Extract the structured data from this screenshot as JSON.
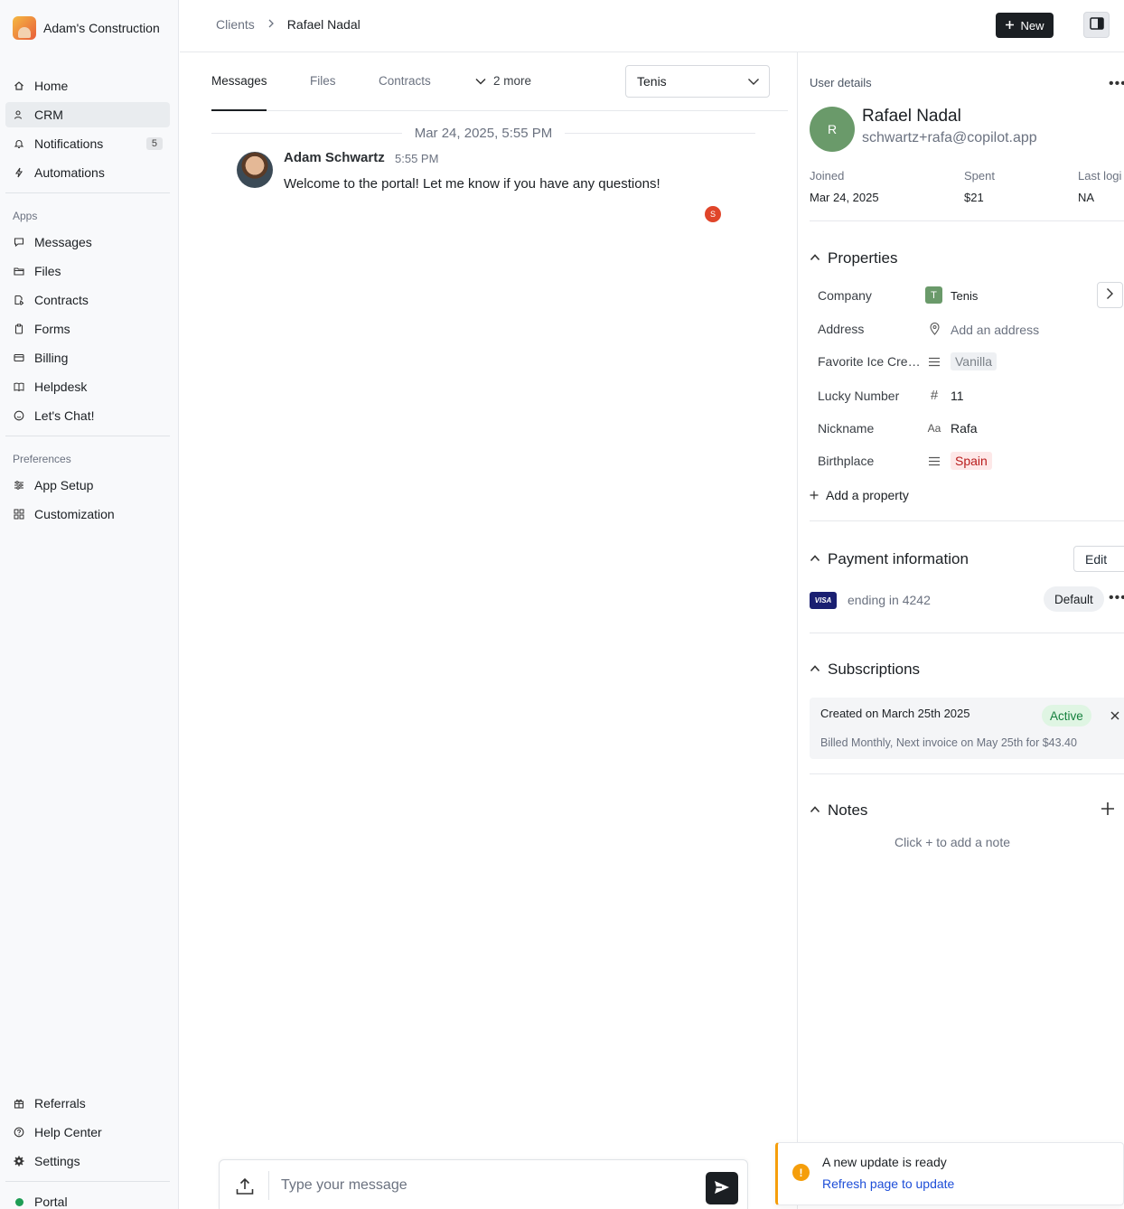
{
  "app": {
    "brand_name": "Adam's Construction"
  },
  "sidebar": {
    "main_items": [
      {
        "label": "Home",
        "icon": "home-icon"
      },
      {
        "label": "CRM",
        "icon": "users-icon",
        "active": true
      },
      {
        "label": "Notifications",
        "icon": "bell-icon",
        "badge": "5"
      },
      {
        "label": "Automations",
        "icon": "bolt-icon"
      }
    ],
    "apps_heading": "Apps",
    "apps_items": [
      {
        "label": "Messages",
        "icon": "message-icon"
      },
      {
        "label": "Files",
        "icon": "folder-icon"
      },
      {
        "label": "Contracts",
        "icon": "contract-icon"
      },
      {
        "label": "Forms",
        "icon": "clipboard-icon"
      },
      {
        "label": "Billing",
        "icon": "credit-card-icon"
      },
      {
        "label": "Helpdesk",
        "icon": "book-icon"
      },
      {
        "label": "Let's Chat!",
        "icon": "smiley-icon"
      }
    ],
    "preferences_heading": "Preferences",
    "preferences_items": [
      {
        "label": "App Setup",
        "icon": "sliders-icon"
      },
      {
        "label": "Customization",
        "icon": "grid-icon"
      }
    ],
    "bottom_items": [
      {
        "label": "Referrals",
        "icon": "gift-icon"
      },
      {
        "label": "Help Center",
        "icon": "help-icon"
      },
      {
        "label": "Settings",
        "icon": "gear-icon"
      }
    ],
    "portal_label": "Portal",
    "portal_status_color": "#1f9d55"
  },
  "header": {
    "breadcrumb": [
      "Clients",
      "Rafael Nadal"
    ],
    "new_button": "New"
  },
  "tabs": {
    "items": [
      "Messages",
      "Files",
      "Contracts"
    ],
    "more_label": "2 more",
    "active": "Messages",
    "company_select": "Tenis"
  },
  "conversation": {
    "date_separator": "Mar 24, 2025, 5:55 PM",
    "messages": [
      {
        "author": "Adam Schwartz",
        "time": "5:55 PM",
        "text": "Welcome to the portal! Let me know if you have any questions!",
        "read_receipt_initial": "S"
      }
    ]
  },
  "composer": {
    "placeholder": "Type your message"
  },
  "user_details": {
    "title": "User details",
    "avatar_initial": "R",
    "name": "Rafael Nadal",
    "email": "schwartz+rafa@copilot.app",
    "stats": [
      {
        "label": "Joined",
        "value": "Mar 24, 2025"
      },
      {
        "label": "Spent",
        "value": "$21"
      },
      {
        "label": "Last logi",
        "value": "NA"
      }
    ]
  },
  "properties": {
    "heading": "Properties",
    "company": {
      "label": "Company",
      "badge": "T",
      "value": "Tenis"
    },
    "address": {
      "label": "Address",
      "placeholder": "Add an address"
    },
    "ice_cream": {
      "label": "Favorite Ice Crea...",
      "value": "Vanilla"
    },
    "lucky_number": {
      "label": "Lucky Number",
      "icon_glyph": "#",
      "value": "11"
    },
    "nickname": {
      "label": "Nickname",
      "icon_glyph": "Aa",
      "value": "Rafa"
    },
    "birthplace": {
      "label": "Birthplace",
      "value": "Spain"
    },
    "add_label": "Add a property"
  },
  "payment": {
    "heading": "Payment information",
    "edit_label": "Edit",
    "card_brand": "VISA",
    "card_text": "ending in 4242",
    "default_label": "Default"
  },
  "subscriptions": {
    "heading": "Subscriptions",
    "created": "Created on March 25th 2025",
    "status": "Active",
    "billing": "Billed Monthly, Next invoice on May 25th for $43.40"
  },
  "notes": {
    "heading": "Notes",
    "empty": "Click + to add a note"
  },
  "toast": {
    "title": "A new update is ready",
    "link": "Refresh page to update"
  }
}
